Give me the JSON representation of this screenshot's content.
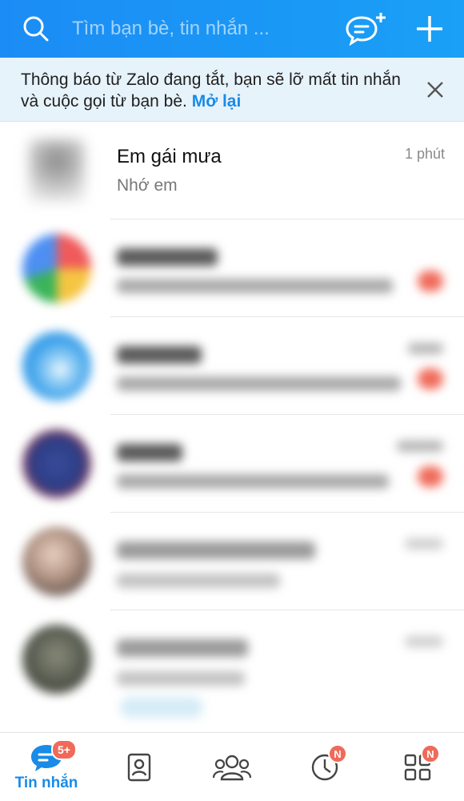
{
  "header": {
    "search_placeholder": "Tìm bạn bè, tin nhắn ..."
  },
  "notice": {
    "text": "Thông báo từ Zalo đang tắt, bạn sẽ lỡ mất tin nhắn và cuộc gọi từ bạn bè.",
    "link": "Mở lại"
  },
  "conversations": [
    {
      "name": "Em gái mưa",
      "preview": "Nhớ em",
      "time": "1 phút"
    }
  ],
  "nav": {
    "messages_label": "Tin nhắn",
    "messages_badge": "5+",
    "timeline_badge": "N",
    "more_badge": "N"
  },
  "colors": {
    "header": "#1b8cf5",
    "notice_bg": "#e7f3fb",
    "accent": "#1a8be6",
    "badge": "#f06a5a"
  }
}
